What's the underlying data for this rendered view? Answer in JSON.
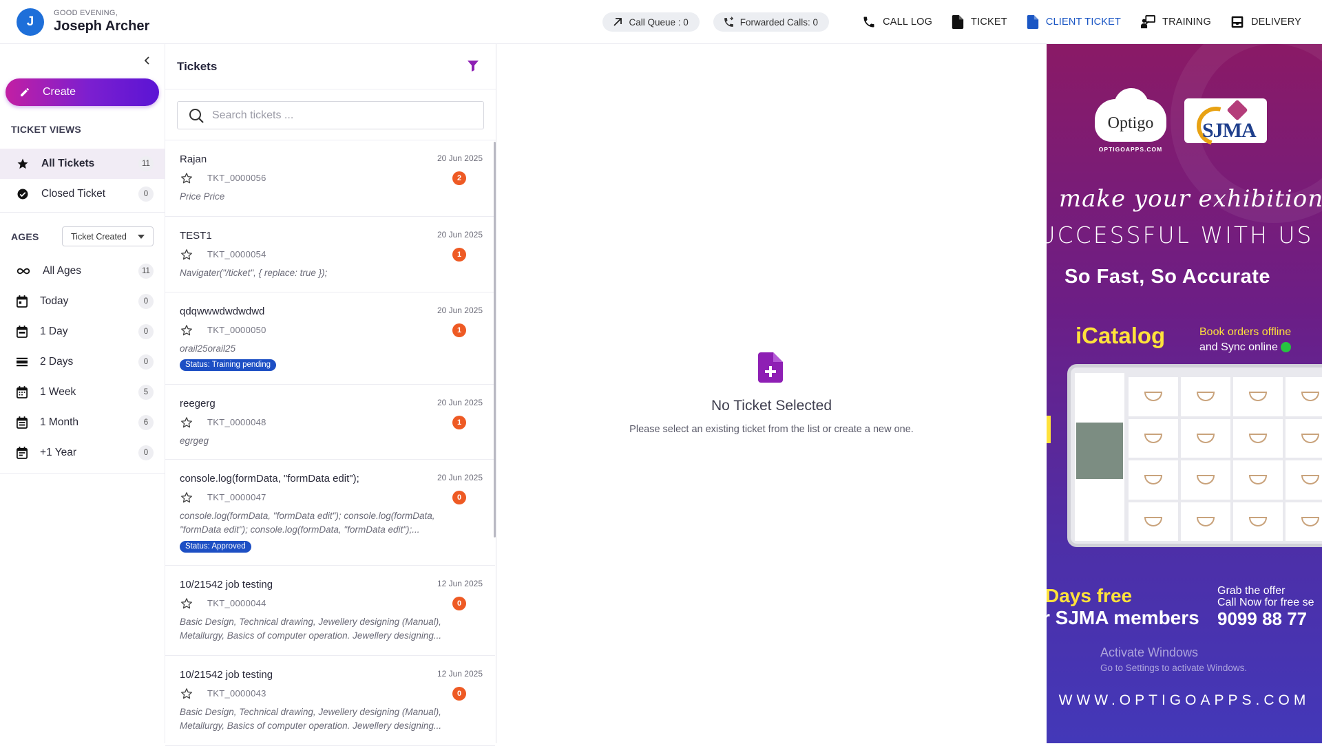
{
  "header": {
    "avatar_letter": "J",
    "greeting": "GOOD EVENING,",
    "user_name": "Joseph Archer",
    "call_queue": "Call Queue : 0",
    "forwarded_calls": "Forwarded Calls: 0",
    "nav": {
      "call_log": "CALL LOG",
      "ticket": "TICKET",
      "client_ticket": "CLIENT TICKET",
      "training": "TRAINING",
      "delivery": "DELIVERY"
    },
    "active_nav": "client_ticket",
    "colors": {
      "avatar": "#1e6fd9",
      "active_nav": "#1a56c4"
    }
  },
  "sidebar": {
    "create_label": "Create",
    "ticket_views_title": "TICKET VIEWS",
    "views": [
      {
        "label": "All Tickets",
        "count": "11",
        "icon": "star-icon",
        "active": true
      },
      {
        "label": "Closed Ticket",
        "count": "0",
        "icon": "check-circle-icon",
        "active": false
      }
    ],
    "ages_title": "AGES",
    "ages_filter": "Ticket Created",
    "ages": [
      {
        "label": "All Ages",
        "count": "11",
        "icon": "infinity-icon"
      },
      {
        "label": "Today",
        "count": "0",
        "icon": "calendar-today-icon"
      },
      {
        "label": "1 Day",
        "count": "0",
        "icon": "calendar-day-icon"
      },
      {
        "label": "2 Days",
        "count": "0",
        "icon": "calendar-view-day-icon"
      },
      {
        "label": "1 Week",
        "count": "5",
        "icon": "calendar-week-icon"
      },
      {
        "label": "1 Month",
        "count": "6",
        "icon": "calendar-month-icon"
      },
      {
        "label": "+1 Year",
        "count": "0",
        "icon": "calendar-year-icon"
      }
    ],
    "colors": {
      "create_gradient_start": "#c21fa3",
      "create_gradient_end": "#5b14d4"
    }
  },
  "tickets": {
    "title": "Tickets",
    "search_placeholder": "Search tickets ...",
    "items": [
      {
        "name": "Rajan",
        "date": "20 Jun 2025",
        "code": "TKT_0000056",
        "count": "2",
        "desc": "Price Price",
        "status": ""
      },
      {
        "name": "TEST1",
        "date": "20 Jun 2025",
        "code": "TKT_0000054",
        "count": "1",
        "desc": "Navigater(\"/ticket\", { replace: true });",
        "status": ""
      },
      {
        "name": "qdqwwwdwdwdwd",
        "date": "20 Jun 2025",
        "code": "TKT_0000050",
        "count": "1",
        "desc": "orail25orail25",
        "status": "Status: Training pending"
      },
      {
        "name": "reegerg",
        "date": "20 Jun 2025",
        "code": "TKT_0000048",
        "count": "1",
        "desc": "egrgeg",
        "status": ""
      },
      {
        "name": "console.log(formData, \"formData edit\");",
        "date": "20 Jun 2025",
        "code": "TKT_0000047",
        "count": "0",
        "desc": "console.log(formData, \"formData edit\"); console.log(formData, \"formData edit\"); console.log(formData, \"formData edit\");...",
        "status": "Status: Approved"
      },
      {
        "name": "10/21542 job testing",
        "date": "12 Jun 2025",
        "code": "TKT_0000044",
        "count": "0",
        "desc": "Basic Design, Technical drawing, Jewellery designing (Manual), Metallurgy, Basics of computer operation. Jewellery designing...",
        "status": ""
      },
      {
        "name": "10/21542 job testing",
        "date": "12 Jun 2025",
        "code": "TKT_0000043",
        "count": "0",
        "desc": "Basic Design, Technical drawing, Jewellery designing (Manual), Metallurgy, Basics of computer operation. Jewellery designing...",
        "status": ""
      }
    ],
    "colors": {
      "count_badge": "#ee5a24",
      "status_badge": "#1d4fc4",
      "filter_icon": "#8e1fb4"
    }
  },
  "detail": {
    "empty_title": "No Ticket Selected",
    "empty_sub": "Please select an existing ticket from the list or create a new one.",
    "icon": "add-document-icon",
    "icon_color": "#8e1fb4"
  },
  "promo": {
    "optigo_logo": "Optigo",
    "optigo_sub": "OPTIGOAPPS.COM",
    "sjma_logo": "SJMA",
    "line1": "make your exhibition",
    "line2": "UCCESSFUL WITH US",
    "fast": "So Fast, So Accurate",
    "icatalog": "iCatalog",
    "book_line1": "Book orders offline",
    "book_line2": "and Sync online",
    "days_free": "Days free",
    "members": "r SJMA members",
    "grab": "Grab the offer",
    "call_now": "Call Now for free se",
    "phone": "9099 88 77",
    "activate_title": "Activate Windows",
    "activate_sub": "Go to Settings to activate Windows.",
    "url": "WWW.OPTIGOAPPS.COM"
  }
}
